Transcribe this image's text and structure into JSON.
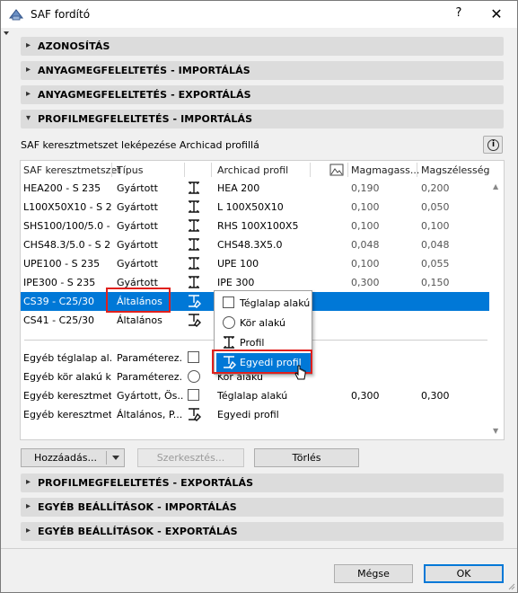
{
  "window": {
    "title": "SAF fordító",
    "help": "?",
    "close": "✕"
  },
  "sections_top": [
    "AZONOSÍTÁS",
    "ANYAGMEGFELELTETÉS - IMPORTÁLÁS",
    "ANYAGMEGFELELTETÉS - EXPORTÁLÁS",
    "PROFILMEGFELELTETÉS - IMPORTÁLÁS"
  ],
  "description": "SAF keresztmetszet leképezése Archicad profillá",
  "columns": {
    "saf": "SAF keresztmetszet",
    "type": "Típus",
    "archicad": "Archicad profil",
    "height": "Magmagass...",
    "width": "Magszélesség"
  },
  "rows": [
    {
      "saf": "HEA200 - S 235",
      "type": "Gyártott",
      "profile": "HEA 200",
      "h": "0,190",
      "w": "0,200"
    },
    {
      "saf": "L100X50X10 - S 235",
      "type": "Gyártott",
      "profile": "L 100X50X10",
      "h": "0,100",
      "w": "0,050"
    },
    {
      "saf": "SHS100/100/5.0 - ...",
      "type": "Gyártott",
      "profile": "RHS 100X100X5",
      "h": "0,100",
      "w": "0,100"
    },
    {
      "saf": "CHS48.3/5.0 - S 235",
      "type": "Gyártott",
      "profile": "CHS48.3X5.0",
      "h": "0,048",
      "w": "0,048"
    },
    {
      "saf": "UPE100 - S 235",
      "type": "Gyártott",
      "profile": "UPE 100",
      "h": "0,100",
      "w": "0,055"
    },
    {
      "saf": "IPE300 - S 235",
      "type": "Gyártott",
      "profile": "IPE 300",
      "h": "0,300",
      "w": "0,150"
    },
    {
      "saf": "CS39 - C25/30",
      "type": "Általános",
      "profile": "",
      "h": "",
      "w": ""
    },
    {
      "saf": "CS41 - C25/30",
      "type": "Általános",
      "profile": "",
      "h": "",
      "w": ""
    }
  ],
  "other_rows": [
    {
      "saf": "Egyéb téglalap al...",
      "type": "Paraméterez...",
      "profile": "",
      "h": "",
      "w": ""
    },
    {
      "saf": "Egyéb kör alakú k...",
      "type": "Paraméterez...",
      "profile": "Kör alakú",
      "h": "",
      "w": ""
    },
    {
      "saf": "Egyéb keresztmet...",
      "type": "Gyártott, Ös...",
      "profile": "Téglalap alakú",
      "h": "0,300",
      "w": "0,300"
    },
    {
      "saf": "Egyéb keresztmet...",
      "type": "Általános, P...",
      "profile": "Egyedi profil",
      "h": "",
      "w": ""
    }
  ],
  "popup": [
    "Téglalap alakú",
    "Kör alakú",
    "Profil",
    "Egyedi profil"
  ],
  "buttons": {
    "add": "Hozzáadás...",
    "edit": "Szerkesztés...",
    "delete": "Törlés",
    "cancel": "Mégse",
    "ok": "OK"
  },
  "sections_bottom": [
    "PROFILMEGFELELTETÉS - EXPORTÁLÁS",
    "EGYÉB BEÁLLÍTÁSOK - IMPORTÁLÁS",
    "EGYÉB BEÁLLÍTÁSOK - EXPORTÁLÁS"
  ],
  "colors": {
    "selection": "#0078d7",
    "highlight": "#e0201d"
  }
}
